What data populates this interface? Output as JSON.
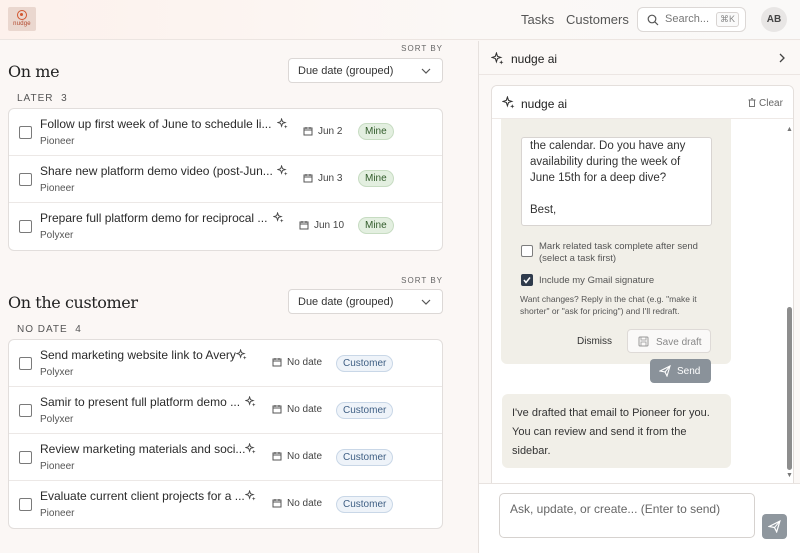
{
  "header": {
    "logo_text": "nudge",
    "nav": [
      "Tasks",
      "Customers"
    ],
    "search_placeholder": "Search...",
    "search_shortcut": "⌘K",
    "avatar_initials": "AB"
  },
  "sections": [
    {
      "title": "On me",
      "sort_label": "SORT BY",
      "sort_value": "Due date (grouped)",
      "group_label": "LATER",
      "group_count": "3",
      "tasks": [
        {
          "title": "Follow up first week of June to schedule li...",
          "customer": "Pioneer",
          "date": "Jun 2",
          "badge": "Mine"
        },
        {
          "title": "Share new platform demo video (post-Jun...",
          "customer": "Pioneer",
          "date": "Jun 3",
          "badge": "Mine"
        },
        {
          "title": "Prepare full platform demo for reciprocal ...",
          "customer": "Polyxer",
          "date": "Jun 10",
          "badge": "Mine"
        }
      ]
    },
    {
      "title": "On the customer",
      "sort_label": "SORT BY",
      "sort_value": "Due date (grouped)",
      "group_label": "NO DATE",
      "group_count": "4",
      "tasks": [
        {
          "title": "Send marketing website link to Avery",
          "customer": "Polyxer",
          "date": "No date",
          "badge": "Customer"
        },
        {
          "title": "Samir to present full platform demo ...",
          "customer": "Polyxer",
          "date": "No date",
          "badge": "Customer"
        },
        {
          "title": "Review marketing materials and soci...",
          "customer": "Pioneer",
          "date": "No date",
          "badge": "Customer"
        },
        {
          "title": "Evaluate current client projects for a ...",
          "customer": "Pioneer",
          "date": "No date",
          "badge": "Customer"
        }
      ]
    }
  ],
  "panel": {
    "title": "nudge ai",
    "card_title": "nudge ai",
    "clear_label": "Clear",
    "email_lines": [
      "the calendar. Do you have any",
      "availability during the week of",
      "June 15th for a deep dive?",
      "",
      "Best,"
    ],
    "option_mark_complete": "Mark related task complete after send (select a task first)",
    "option_gmail_signature": "Include my Gmail signature",
    "hint": "Want changes? Reply in the chat (e.g. \"make it shorter\" or \"ask for pricing\") and I'll redraft.",
    "dismiss_label": "Dismiss",
    "save_draft_label": "Save draft",
    "send_label": "Send",
    "assistant_message": "I've drafted that email to Pioneer for you. You can review and send it from the sidebar.",
    "input_placeholder": "Ask, update, or create... (Enter to send)"
  },
  "colors": {
    "brand": "#d2552e",
    "mine_badge": "#e3efe0",
    "customer_badge": "#eef3f9",
    "ai_bubble": "#f1efe8"
  }
}
